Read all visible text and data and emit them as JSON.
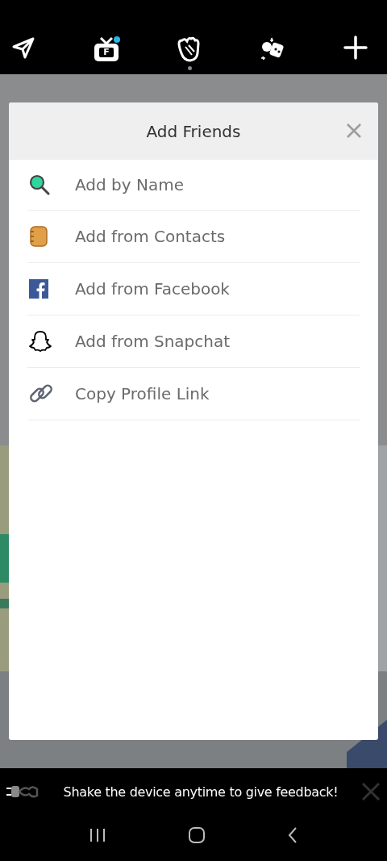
{
  "top_tabs": [
    {
      "kind": "send",
      "selected": false
    },
    {
      "kind": "tv",
      "selected": false,
      "letter": "F",
      "unread": true
    },
    {
      "kind": "wave",
      "selected": true
    },
    {
      "kind": "karaoke",
      "selected": false
    },
    {
      "kind": "plus",
      "selected": false
    }
  ],
  "dialog": {
    "title": "Add Friends",
    "items": [
      {
        "kind": "search",
        "label": "Add by Name"
      },
      {
        "kind": "contacts",
        "label": "Add from Contacts"
      },
      {
        "kind": "facebook",
        "label": "Add from Facebook"
      },
      {
        "kind": "snapchat",
        "label": "Add from Snapchat"
      },
      {
        "kind": "link",
        "label": "Copy Profile Link"
      }
    ]
  },
  "toast": {
    "text": "Shake the device anytime to give feedback!"
  }
}
